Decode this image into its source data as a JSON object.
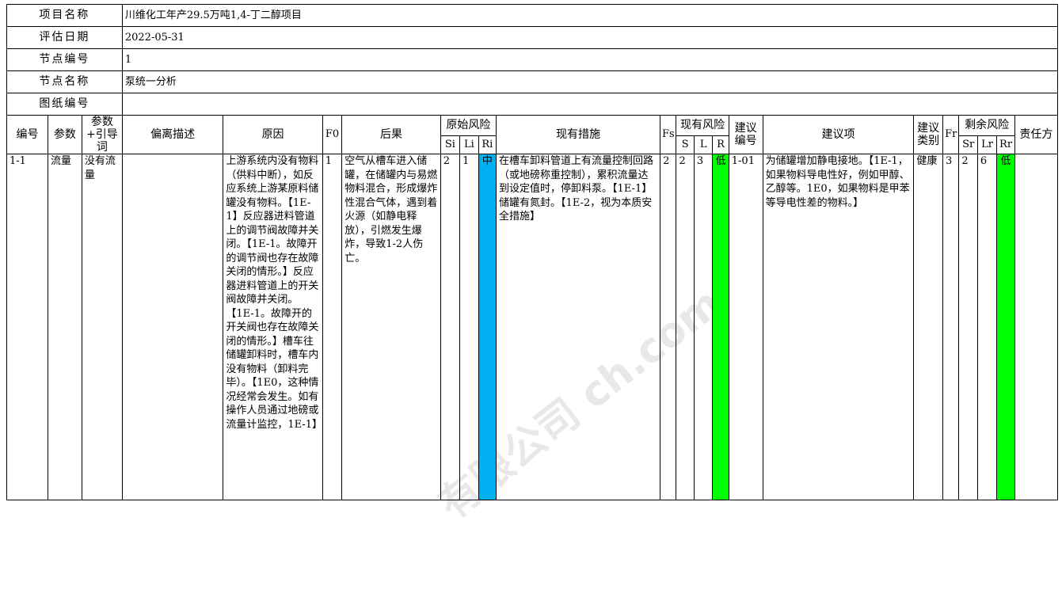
{
  "project_info": {
    "rows": [
      {
        "label": "项目名称",
        "value": "川维化工年产29.5万吨1,4-丁二醇项目"
      },
      {
        "label": "评估日期",
        "value": "2022-05-31"
      },
      {
        "label": "节点编号",
        "value": "1"
      },
      {
        "label": "节点名称",
        "value": "泵统一分析"
      },
      {
        "label": "图纸编号",
        "value": ""
      }
    ]
  },
  "table_headers": {
    "id": "编号",
    "param": "参数",
    "guideword": "参数+引导词",
    "deviation": "偏离描述",
    "cause": "原因",
    "f0": "F0",
    "consequence": "后果",
    "original_risk": "原始风险",
    "si": "Si",
    "li": "Li",
    "ri": "Ri",
    "existing_measures": "现有措施",
    "fs": "Fs",
    "existing_risk": "现有风险",
    "s": "S",
    "l": "L",
    "r": "R",
    "rec_no": "建议编号",
    "recommendation": "建议项",
    "rec_type": "建议类别",
    "fr": "Fr",
    "residual_risk": "剩余风险",
    "sr": "Sr",
    "lr": "Lr",
    "rr": "Rr",
    "owner": "责任方"
  },
  "row": {
    "id": "1-1",
    "param": "流量",
    "guideword": "没有流量",
    "deviation": "",
    "cause": "上游系统内没有物料（供料中断），如反应系统上游某原料储罐没有物料。【1E-1】反应器进料管道上的调节阀故障并关闭。【1E-1。故障开的调节阀也存在故障关闭的情形。】反应器进料管道上的开关阀故障并关闭。【1E-1。故障开的开关阀也存在故障关闭的情形。】槽车往储罐卸料时，槽车内没有物料（卸料完毕）。【1E0，这种情况经常会发生。如有操作人员通过地磅或流量计监控，1E-1】",
    "f0": "1",
    "consequence": "空气从槽车进入储罐，在储罐内与易燃物料混合，形成爆炸性混合气体，遇到着火源（如静电释放），引燃发生爆炸，导致1-2人伤亡。",
    "si": "2",
    "li": "1",
    "ri": "中",
    "existing_measures": "在槽车卸料管道上有流量控制回路（或地磅称重控制），累积流量达到设定值时，停卸料泵。【1E-1】储罐有氮封。【1E-2，视为本质安全措施】",
    "fs": "2",
    "s": "2",
    "l": "3",
    "r": "低",
    "rec_no": "1-01",
    "recommendation": "为储罐增加静电接地。【1E-1，如果物料导电性好，例如甲醇、乙醇等。1E0，如果物料是甲苯等导电性差的物料。】",
    "rec_type": "健康",
    "fr": "3",
    "sr": "2",
    "lr": "6",
    "rr": "低",
    "owner": ""
  },
  "colors": {
    "ri_medium": "#00b0f0",
    "risk_low": "#00ff00"
  },
  "watermark": "有限公司 ch.com"
}
